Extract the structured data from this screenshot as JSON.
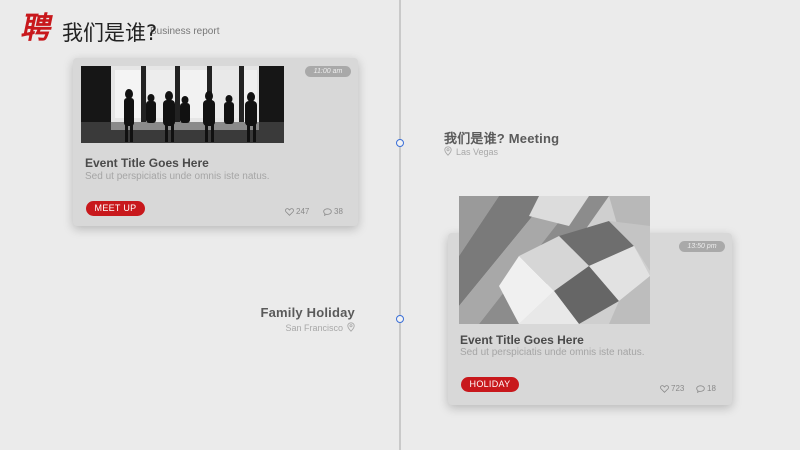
{
  "header": {
    "logo_char": "聘",
    "title": "我们是谁?",
    "subtitle": "Business report"
  },
  "events": [
    {
      "title": "我们是谁?   Meeting",
      "location": "Las Vegas",
      "icon": "location-pin-icon"
    },
    {
      "title": "Family  Holiday",
      "location": "San Francisco",
      "icon": "location-pin-icon"
    }
  ],
  "cards": [
    {
      "time": "11:00 am",
      "title": "Event Title Goes Here",
      "description": "Sed ut perspiciatis  unde omnis iste natus.",
      "tag": "MEET UP",
      "likes": "247",
      "comments": "38"
    },
    {
      "time": "13:50 pm",
      "title": "Event Title Goes Here",
      "description": "Sed ut perspiciatis  unde omnis iste natus.",
      "tag": "HOLIDAY",
      "likes": "723",
      "comments": "18"
    }
  ],
  "colors": {
    "accent": "#c8181c",
    "timeline_dot": "#3a6fd8",
    "background": "#ebebeb",
    "card": "#d8d8d8"
  }
}
